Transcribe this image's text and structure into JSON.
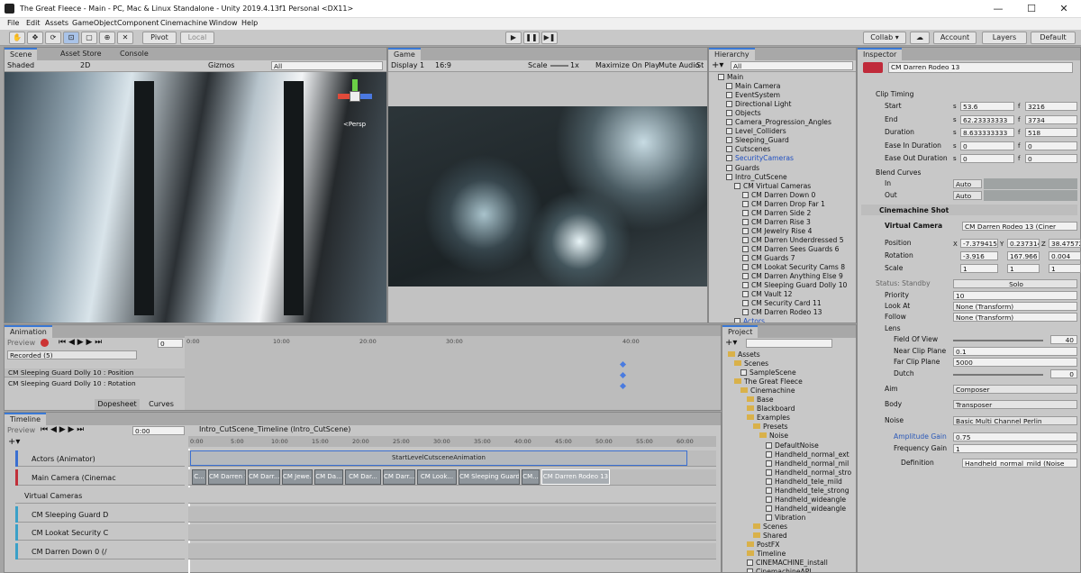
{
  "window": {
    "title": "The Great Fleece - Main - PC, Mac & Linux Standalone - Unity 2019.4.13f1 Personal <DX11>",
    "min": "—",
    "max": "☐",
    "close": "✕"
  },
  "menu": [
    "File",
    "Edit",
    "Assets",
    "GameObject",
    "Component",
    "Cinemachine",
    "Window",
    "Help"
  ],
  "toolbar": {
    "pivot": "Pivot",
    "local": "Local",
    "collab": "Collab ▾",
    "account": "Account",
    "layers": "Layers",
    "layout": "Default"
  },
  "scene": {
    "tabs": [
      "Scene",
      "Asset Store",
      "Console"
    ],
    "shading": "Shaded",
    "mode2d": "2D",
    "gizmos": "Gizmos",
    "search": "All",
    "persp": "<Persp"
  },
  "game": {
    "tab": "Game",
    "display": "Display 1",
    "aspect": "16:9",
    "scale_label": "Scale",
    "scale_value": "1x",
    "maximize": "Maximize On Play",
    "mute": "Mute Audio",
    "stats": "St"
  },
  "hierarchy": {
    "tab": "Hierarchy",
    "search": "All",
    "items": [
      {
        "label": "Main",
        "indent": 0,
        "type": "scene"
      },
      {
        "label": "Main Camera",
        "indent": 1
      },
      {
        "label": "EventSystem",
        "indent": 1
      },
      {
        "label": "Directional Light",
        "indent": 1
      },
      {
        "label": "Objects",
        "indent": 1
      },
      {
        "label": "Camera_Progression_Angles",
        "indent": 1
      },
      {
        "label": "Level_Colliders",
        "indent": 1
      },
      {
        "label": "Sleeping_Guard",
        "indent": 1
      },
      {
        "label": "Cutscenes",
        "indent": 1
      },
      {
        "label": "SecurityCameras",
        "indent": 1,
        "blue": true
      },
      {
        "label": "Guards",
        "indent": 1
      },
      {
        "label": "Intro_CutScene",
        "indent": 1
      },
      {
        "label": "CM Virtual Cameras",
        "indent": 2
      },
      {
        "label": "CM Darren Down 0",
        "indent": 3
      },
      {
        "label": "CM Darren Drop Far 1",
        "indent": 3
      },
      {
        "label": "CM Darren Side 2",
        "indent": 3
      },
      {
        "label": "CM Darren Rise 3",
        "indent": 3
      },
      {
        "label": "CM Jewelry Rise 4",
        "indent": 3
      },
      {
        "label": "CM Darren Underdressed 5",
        "indent": 3
      },
      {
        "label": "CM Darren Sees Guards 6",
        "indent": 3
      },
      {
        "label": "CM Guards 7",
        "indent": 3
      },
      {
        "label": "CM Lookat Security Cams 8",
        "indent": 3
      },
      {
        "label": "CM Darren Anything Else 9",
        "indent": 3
      },
      {
        "label": "CM Sleeping Guard Dolly 10",
        "indent": 3
      },
      {
        "label": "CM Vault 12",
        "indent": 3
      },
      {
        "label": "CM Security Card 11",
        "indent": 3
      },
      {
        "label": "CM Darren Rodeo 13",
        "indent": 3
      },
      {
        "label": "Actors",
        "indent": 2,
        "blue": true
      }
    ]
  },
  "inspector": {
    "tab": "Inspector",
    "object_name": "CM Darren Rodeo 13",
    "clip_timing": "Clip Timing",
    "rows": [
      {
        "label": "Start",
        "s": "53.6",
        "f": "3216"
      },
      {
        "label": "End",
        "s": "62.23333333",
        "f": "3734"
      },
      {
        "label": "Duration",
        "s": "8.633333333",
        "f": "518"
      },
      {
        "label": "Ease In Duration",
        "s": "0",
        "f": "0"
      },
      {
        "label": "Ease Out Duration",
        "s": "0",
        "f": "0"
      }
    ],
    "s_label": "s",
    "f_label": "f",
    "blend_curves": "Blend Curves",
    "in_label": "In",
    "out_label": "Out",
    "auto": "Auto",
    "shot_header": "Cinemachine Shot",
    "virtual_camera_label": "Virtual Camera",
    "virtual_camera": "CM Darren Rodeo 13 (Ciner",
    "position": {
      "label": "Position",
      "x": "-7.379415",
      "y": "0.237314",
      "z": "38.47572"
    },
    "rotation": {
      "label": "Rotation",
      "x": "-3.916",
      "y": "167.966",
      "z": "0.004"
    },
    "scale": {
      "label": "Scale",
      "x": "1",
      "y": "1",
      "z": "1"
    },
    "status": "Status: Standby",
    "solo": "Solo",
    "priority_label": "Priority",
    "priority": "10",
    "lookat_label": "Look At",
    "lookat": "None (Transform)",
    "follow_label": "Follow",
    "follow": "None (Transform)",
    "lens": "Lens",
    "fov_label": "Field Of View",
    "fov": "40",
    "near_label": "Near Clip Plane",
    "near": "0.1",
    "far_label": "Far Clip Plane",
    "far": "5000",
    "dutch_label": "Dutch",
    "dutch": "0",
    "aim_label": "Aim",
    "aim": "Composer",
    "body_label": "Body",
    "body": "Transposer",
    "noise_label": "Noise",
    "noise": "Basic Multi Channel Perlin",
    "amp_label": "Amplitude Gain",
    "amp": "0.75",
    "freq_label": "Frequency Gain",
    "freq": "1",
    "def_label": "Definition",
    "def": "Handheld_normal_mild (Noise"
  },
  "animation": {
    "tab": "Animation",
    "preview": "Preview",
    "frame": "0",
    "clip": "Recorded (5)",
    "props": [
      "CM Sleeping Guard Dolly 10 : Position",
      "CM Sleeping Guard Dolly 10 : Rotation"
    ],
    "dopesheet": "Dopesheet",
    "curves": "Curves",
    "ruler": [
      "0:00",
      "10:00",
      "20:00",
      "30:00",
      "40:00"
    ]
  },
  "timeline": {
    "tab": "Timeline",
    "preview": "Preview",
    "time": "0:00",
    "asset": "Intro_CutScene_Timeline (Intro_CutScene)",
    "ruler": [
      "0:00",
      "5:00",
      "10:00",
      "15:00",
      "20:00",
      "25:00",
      "30:00",
      "35:00",
      "40:00",
      "45:00",
      "50:00",
      "55:00",
      "60:00"
    ],
    "tracks": [
      {
        "label": "Actors (Animator)"
      },
      {
        "label": "Main Camera (Cinemac"
      },
      {
        "label": "Virtual Cameras",
        "group": true
      },
      {
        "label": "CM Sleeping Guard D"
      },
      {
        "label": "CM Lookat Security C"
      },
      {
        "label": "CM Darren Down 0 (/"
      }
    ],
    "anim_clip": "StartLevelCutsceneAnimation",
    "shots": [
      "C...",
      "CM Darren S...",
      "CM Darr...",
      "CM Jewe...",
      "CM Da...",
      "CM Dar...",
      "CM Darr...",
      "CM Look...",
      "CM Sleeping Guard D...",
      "CM...",
      "CM Darren Rodeo 13"
    ]
  },
  "project": {
    "tab": "Project",
    "items": [
      {
        "label": "Assets",
        "indent": 0,
        "folder": true
      },
      {
        "label": "Scenes",
        "indent": 1,
        "folder": true
      },
      {
        "label": "SampleScene",
        "indent": 2
      },
      {
        "label": "The Great Fleece",
        "indent": 1,
        "folder": true
      },
      {
        "label": "Cinemachine",
        "indent": 2,
        "folder": true
      },
      {
        "label": "Base",
        "indent": 3,
        "folder": true
      },
      {
        "label": "Blackboard",
        "indent": 3,
        "folder": true
      },
      {
        "label": "Examples",
        "indent": 3,
        "folder": true
      },
      {
        "label": "Presets",
        "indent": 4,
        "folder": true
      },
      {
        "label": "Noise",
        "indent": 5,
        "folder": true
      },
      {
        "label": "DefaultNoise",
        "indent": 6
      },
      {
        "label": "Handheld_normal_ext",
        "indent": 6
      },
      {
        "label": "Handheld_normal_mil",
        "indent": 6
      },
      {
        "label": "Handheld_normal_stro",
        "indent": 6
      },
      {
        "label": "Handheld_tele_mild",
        "indent": 6
      },
      {
        "label": "Handheld_tele_strong",
        "indent": 6
      },
      {
        "label": "Handheld_wideangle",
        "indent": 6
      },
      {
        "label": "Handheld_wideangle",
        "indent": 6
      },
      {
        "label": "Vibration",
        "indent": 6
      },
      {
        "label": "Scenes",
        "indent": 4,
        "folder": true
      },
      {
        "label": "Shared",
        "indent": 4,
        "folder": true
      },
      {
        "label": "PostFX",
        "indent": 3,
        "folder": true
      },
      {
        "label": "Timeline",
        "indent": 3,
        "folder": true
      },
      {
        "label": "CINEMACHINE_install",
        "indent": 3
      },
      {
        "label": "CinemachineAPI",
        "indent": 3
      }
    ]
  }
}
